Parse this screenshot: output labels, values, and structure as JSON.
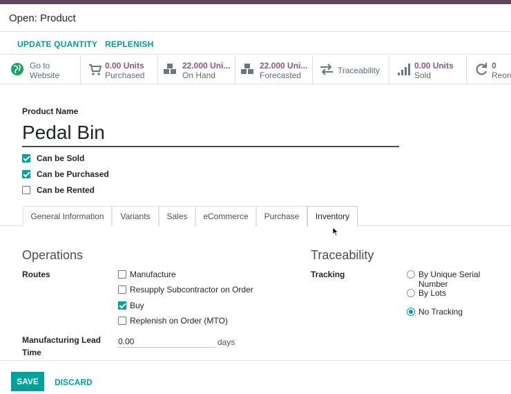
{
  "dialog": {
    "title": "Open: Product"
  },
  "actions": {
    "update_quantity": "UPDATE QUANTITY",
    "replenish": "REPLENISH"
  },
  "smart_buttons": [
    {
      "icon": "globe-icon",
      "line1": "Go to",
      "line2": "Website"
    },
    {
      "icon": "cart-icon",
      "value": "0.00 Units",
      "label": "Purchased"
    },
    {
      "icon": "cubes-icon",
      "value": "22.000 Uni...",
      "label": "On Hand"
    },
    {
      "icon": "cubes-icon",
      "value": "22.000 Uni...",
      "label": "Forecasted"
    },
    {
      "icon": "arrows-exchange-icon",
      "label": "Traceability"
    },
    {
      "icon": "signal-bars-icon",
      "value": "0.00 Units",
      "label": "Sold"
    },
    {
      "icon": "refresh-icon",
      "value": "0",
      "label": "Reord"
    }
  ],
  "form": {
    "product_name_label": "Product Name",
    "product_name": "Pedal Bin",
    "options": [
      {
        "label": "Can be Sold",
        "checked": true
      },
      {
        "label": "Can be Purchased",
        "checked": true
      },
      {
        "label": "Can be Rented",
        "checked": false
      }
    ]
  },
  "tabs": [
    {
      "label": "General Information",
      "active": false
    },
    {
      "label": "Variants",
      "active": false
    },
    {
      "label": "Sales",
      "active": false
    },
    {
      "label": "eCommerce",
      "active": false
    },
    {
      "label": "Purchase",
      "active": false
    },
    {
      "label": "Inventory",
      "active": true
    }
  ],
  "operations": {
    "title": "Operations",
    "routes_label": "Routes",
    "routes": [
      {
        "label": "Manufacture",
        "checked": false
      },
      {
        "label": "Resupply Subcontractor on Order",
        "checked": false
      },
      {
        "label": "Buy",
        "checked": true
      },
      {
        "label": "Replenish on Order (MTO)",
        "checked": false
      }
    ],
    "lead_time_label_1": "Manufacturing Lead",
    "lead_time_label_2": "Time",
    "lead_time_value": "0.00",
    "lead_time_unit": "days"
  },
  "traceability": {
    "title": "Traceability",
    "tracking_label": "Tracking",
    "options": [
      {
        "label": "By Unique Serial Number",
        "selected": false
      },
      {
        "label": "By Lots",
        "selected": false
      },
      {
        "label": "No Tracking",
        "selected": true
      }
    ]
  },
  "footer": {
    "save": "SAVE",
    "discard": "DISCARD"
  },
  "colors": {
    "accent": "#00a09d",
    "stat_value": "#875a7b",
    "header_strip": "#5e4559"
  }
}
